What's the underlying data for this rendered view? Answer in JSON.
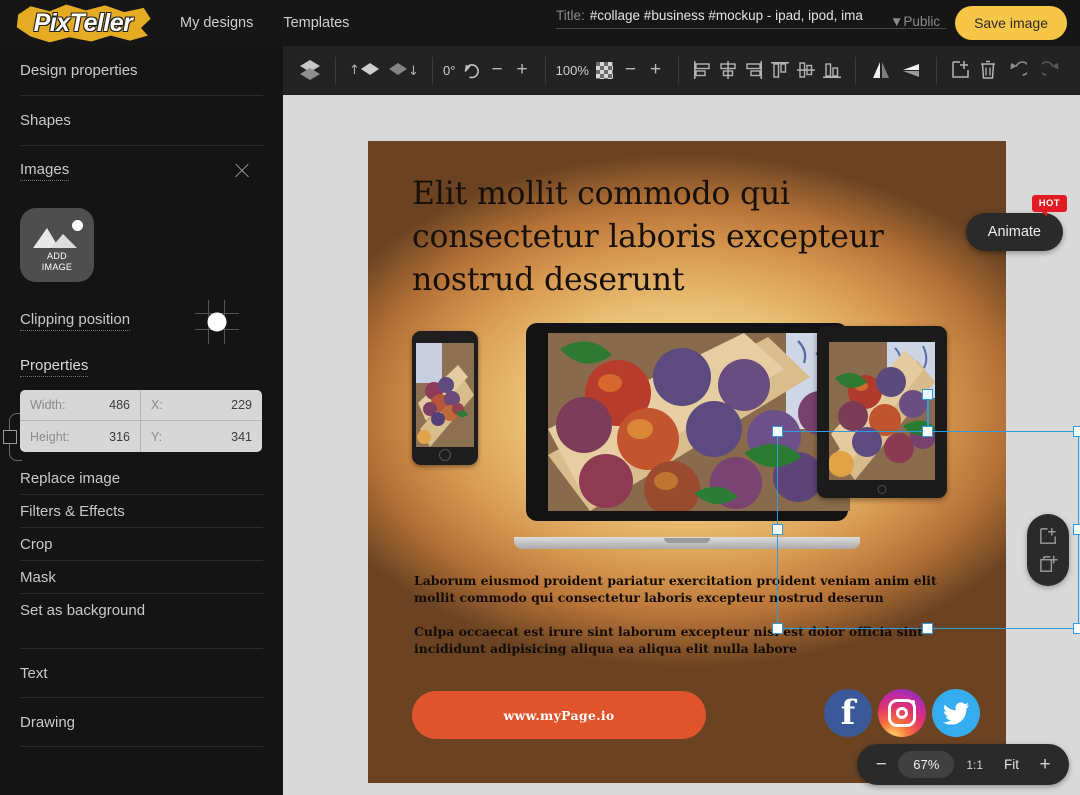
{
  "app": {
    "logo_text": "PixTeller"
  },
  "topnav": [
    {
      "label": "My designs",
      "name": "nav-my-designs"
    },
    {
      "label": "Templates",
      "name": "nav-templates"
    }
  ],
  "title": {
    "label": "Title:",
    "value": "#collage #business #mockup - ipad, ipod, ima",
    "placeholder": "Title"
  },
  "visibility": {
    "value": "Public",
    "caret": "▼"
  },
  "save": {
    "label": "Save image"
  },
  "toolbar": {
    "layers_icon": "layers-icon",
    "bring_forward_icon": "bring-forward-icon",
    "send_backward_icon": "send-backward-icon",
    "rotation_value": "0°",
    "rotation_icon": "rotate-icon",
    "rotation_minus": "−",
    "rotation_plus": "+",
    "opacity_value": "100%",
    "opacity_icon": "transparency-checker-icon",
    "opacity_minus": "−",
    "opacity_plus": "+",
    "align_left_icon": "align-left-icon",
    "align_center_icon": "align-center-horizontal-icon",
    "align_right_icon": "align-right-icon",
    "align_top_icon": "align-top-icon",
    "align_middle_icon": "align-middle-vertical-icon",
    "align_bottom_icon": "align-bottom-icon",
    "flip_horizontal_icon": "flip-horizontal-icon",
    "flip_vertical_icon": "flip-vertical-icon",
    "duplicate_icon": "duplicate-icon",
    "delete_icon": "trash-icon",
    "undo_icon": "undo-icon",
    "redo_icon": "redo-icon"
  },
  "sidebar": {
    "design_properties": "Design properties",
    "shapes": "Shapes",
    "images": "Images",
    "images_close_icon": "close-icon",
    "add_image": {
      "line1": "ADD",
      "line2": "IMAGE",
      "icon": "image-placeholder-icon"
    },
    "clipping_position": "Clipping position",
    "properties": "Properties",
    "fields": [
      {
        "key": "Width:",
        "value": "486",
        "name": "width-field"
      },
      {
        "key": "X:",
        "value": "229",
        "name": "x-field"
      },
      {
        "key": "Height:",
        "value": "316",
        "name": "height-field"
      },
      {
        "key": "Y:",
        "value": "341",
        "name": "y-field"
      }
    ],
    "actions": [
      {
        "label": "Replace image",
        "name": "sidebar-item-replace-image"
      },
      {
        "label": "Filters & Effects",
        "name": "sidebar-item-filters-effects"
      },
      {
        "label": "Crop",
        "name": "sidebar-item-crop"
      },
      {
        "label": "Mask",
        "name": "sidebar-item-mask"
      },
      {
        "label": "Set as background",
        "name": "sidebar-item-set-as-background"
      }
    ],
    "text": "Text",
    "drawing": "Drawing"
  },
  "artboard": {
    "headline": "Elit mollit commodo qui consectetur laboris excepteur nostrud deserunt",
    "paragraph1": "Laborum eiusmod proident pariatur exercitation proident veniam anim elit mollit commodo qui consectetur laboris excepteur nostrud deserun",
    "paragraph2": "Culpa occaecat est irure sint laborum excepteur nisi est dolor officia sint incididunt adipisicing aliqua ea aliqua elit nulla labore",
    "cta_label": "www.myPage.io",
    "socials": [
      {
        "name": "facebook-icon",
        "label": "Facebook"
      },
      {
        "name": "instagram-icon",
        "label": "Instagram"
      },
      {
        "name": "twitter-icon",
        "label": "Twitter"
      }
    ]
  },
  "animate": {
    "label": "Animate",
    "badge": "HOT"
  },
  "pages": {
    "add_page_icon": "add-page-icon",
    "duplicate_page_icon": "duplicate-page-icon"
  },
  "zoom": {
    "minus": "−",
    "percent": "67%",
    "one_to_one": "1:1",
    "fit": "Fit",
    "plus": "+"
  },
  "colors": {
    "accent_yellow": "#f8c646",
    "cta_orange": "#e0542c",
    "selection_blue": "#2f9ce0",
    "hot_red": "#e21b22",
    "facebook_blue": "#3b5998",
    "twitter_blue": "#35acee"
  }
}
